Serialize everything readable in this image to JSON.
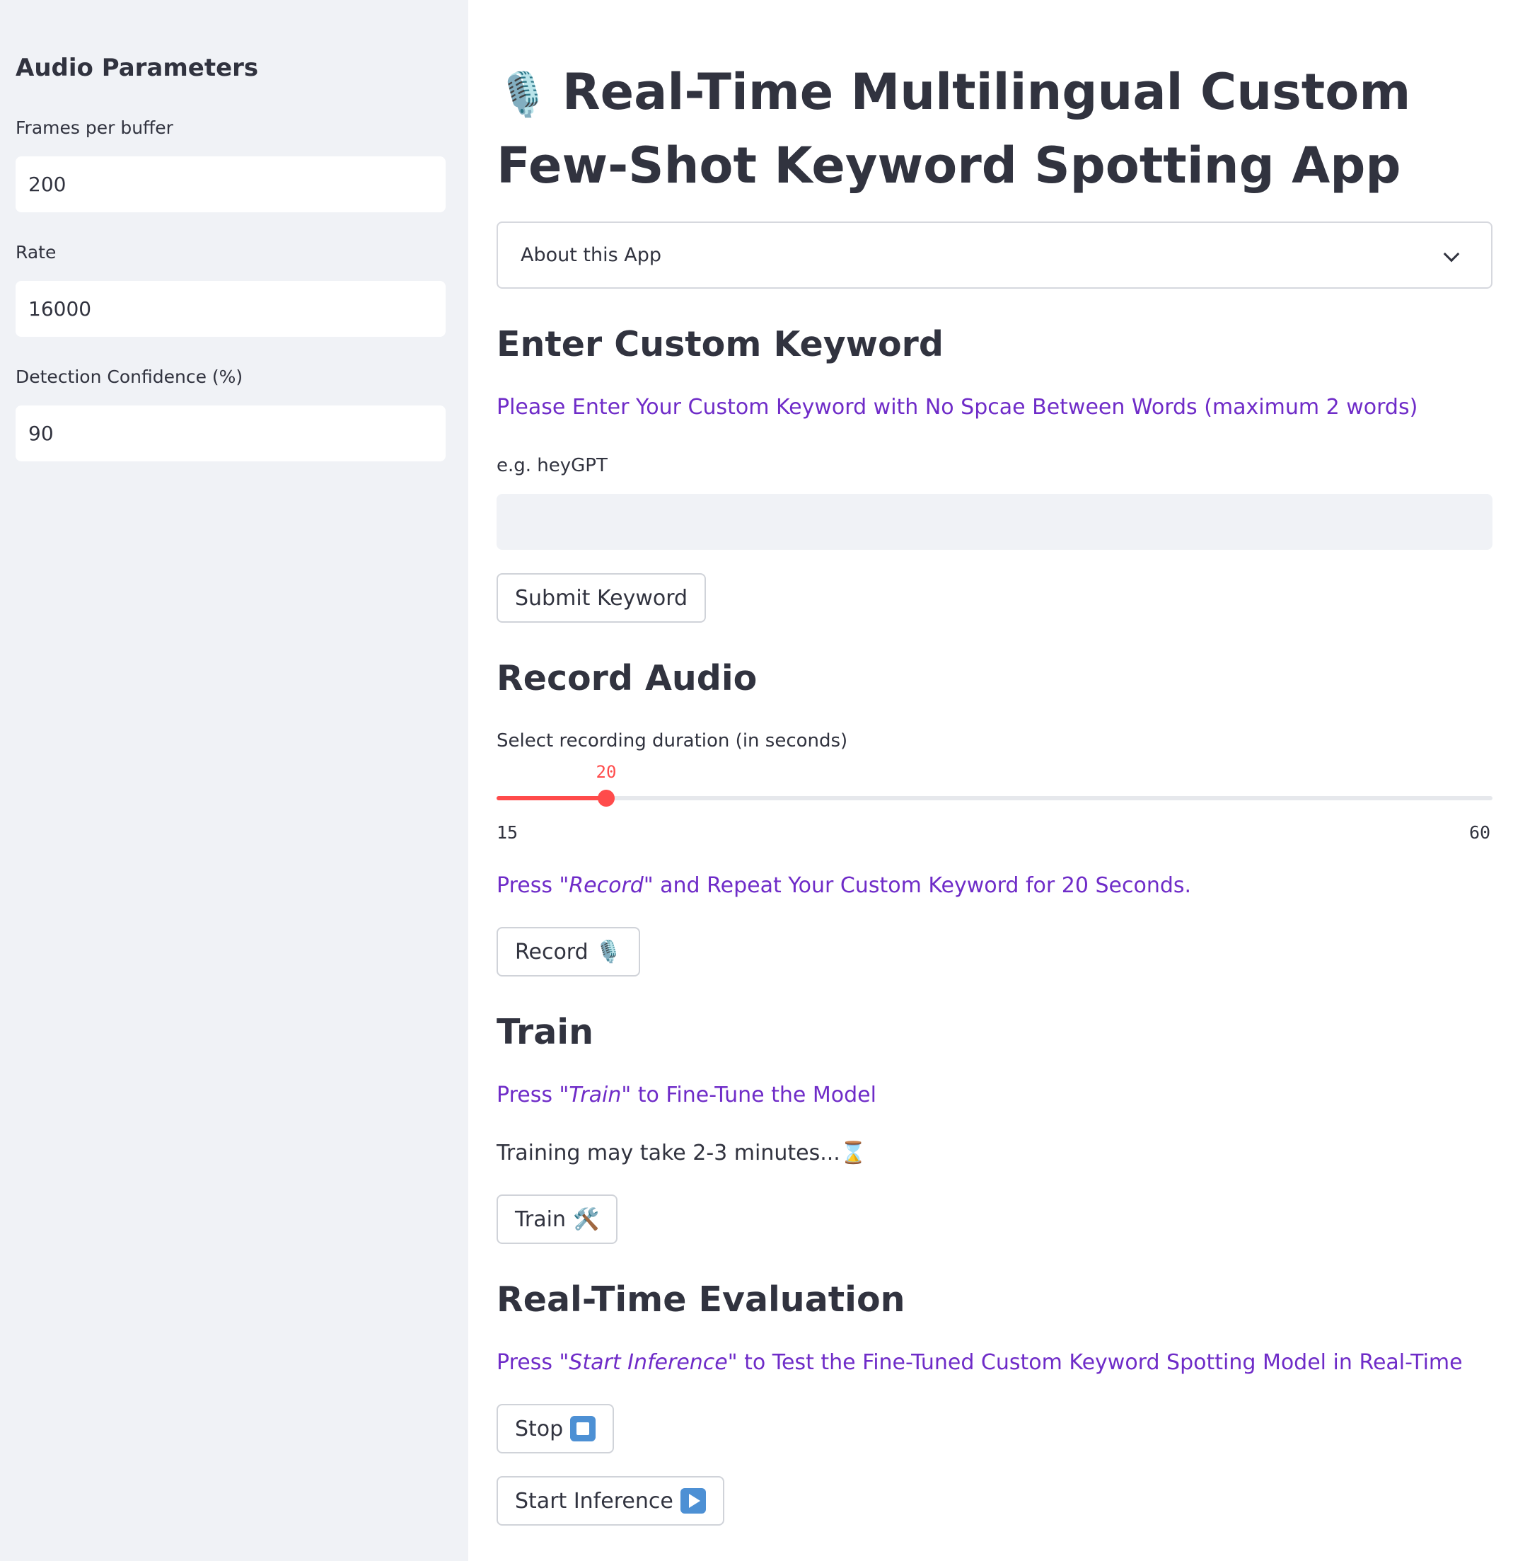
{
  "sidebar": {
    "title": "Audio Parameters",
    "fields": [
      {
        "label": "Frames per buffer",
        "value": "200"
      },
      {
        "label": "Rate",
        "value": "16000"
      },
      {
        "label": "Detection Confidence (%)",
        "value": "90"
      }
    ]
  },
  "main": {
    "title": "Real-Time Multilingual Custom Few-Shot Keyword Spotting App",
    "title_icon": "🎙️",
    "expander": {
      "label": "About this App",
      "icon": "chevron-down-icon"
    },
    "keyword_section": {
      "heading": "Enter Custom Keyword",
      "instruction": "Please Enter Your Custom Keyword with No Spcae Between Words (maximum 2 words)",
      "input_label": "e.g. heyGPT",
      "input_value": "",
      "submit_label": "Submit Keyword"
    },
    "record_section": {
      "heading": "Record Audio",
      "slider_label": "Select recording duration (in seconds)",
      "slider_min": "15",
      "slider_max": "60",
      "slider_value": "20",
      "instruction_pre": "Press \"",
      "instruction_em": "Record",
      "instruction_post": "\" and Repeat Your Custom Keyword for 20 Seconds.",
      "record_label": "Record",
      "record_icon": "🎙️"
    },
    "train_section": {
      "heading": "Train",
      "instruction_pre": "Press \"",
      "instruction_em": "Train",
      "instruction_post": "\" to Fine-Tune the Model",
      "note": "Training may take 2-3 minutes...",
      "note_icon": "⌛",
      "train_label": "Train",
      "train_icon": "🛠️"
    },
    "eval_section": {
      "heading": "Real-Time Evaluation",
      "instruction_pre": "Press \"",
      "instruction_em": "Start Inference",
      "instruction_post": "\" to Test the Fine-Tuned Custom Keyword Spotting Model in Real-Time",
      "stop_label": "Stop",
      "start_label": "Start Inference"
    }
  },
  "colors": {
    "accent": "#ff4b4b",
    "instruction_text": "#6f2cc8",
    "sidebar_bg": "#f0f2f6",
    "button_icon": "#4d90d4"
  }
}
